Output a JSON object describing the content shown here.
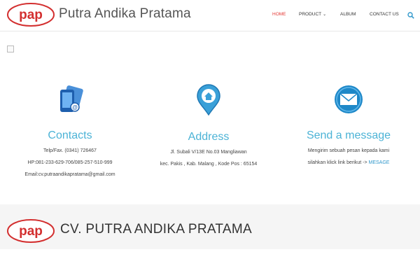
{
  "header": {
    "logo_text": "pap",
    "brand": "Putra Andika Pratama",
    "nav": {
      "home": "HOME",
      "product": "PRODUCT",
      "album": "ALBUM",
      "contact": "CONTACT US"
    },
    "search_icon": "search-icon"
  },
  "columns": {
    "contacts": {
      "title": "Contacts",
      "icon": "phone-icon",
      "line1": "Telp/Fax. (0341) 726467",
      "line2": "HP:081-233-629-706/085-257-510-999",
      "line3": "Email:cv.putraandikapratama@gmail.com"
    },
    "address": {
      "title": "Address",
      "icon": "location-pin-icon",
      "line1": "Jl. Subali V/13E No.03 Mangliawan",
      "line2": "kec. Pakis , Kab. Malang , Kode Pos : 65154"
    },
    "message": {
      "title": "Send a message",
      "icon": "envelope-icon",
      "line1": "Mengirim sebuah pesan kepada kami",
      "line2_prefix": "silahkan klick link berikut ->",
      "link": "MESAGE"
    }
  },
  "footer": {
    "logo_text": "pap",
    "title": "CV. PUTRA ANDIKA PRATAMA"
  },
  "colors": {
    "accent": "#4cb3d6",
    "nav_active": "#e53935",
    "logo_red": "#d32f2f",
    "footer_bg": "#f5f5f5"
  }
}
